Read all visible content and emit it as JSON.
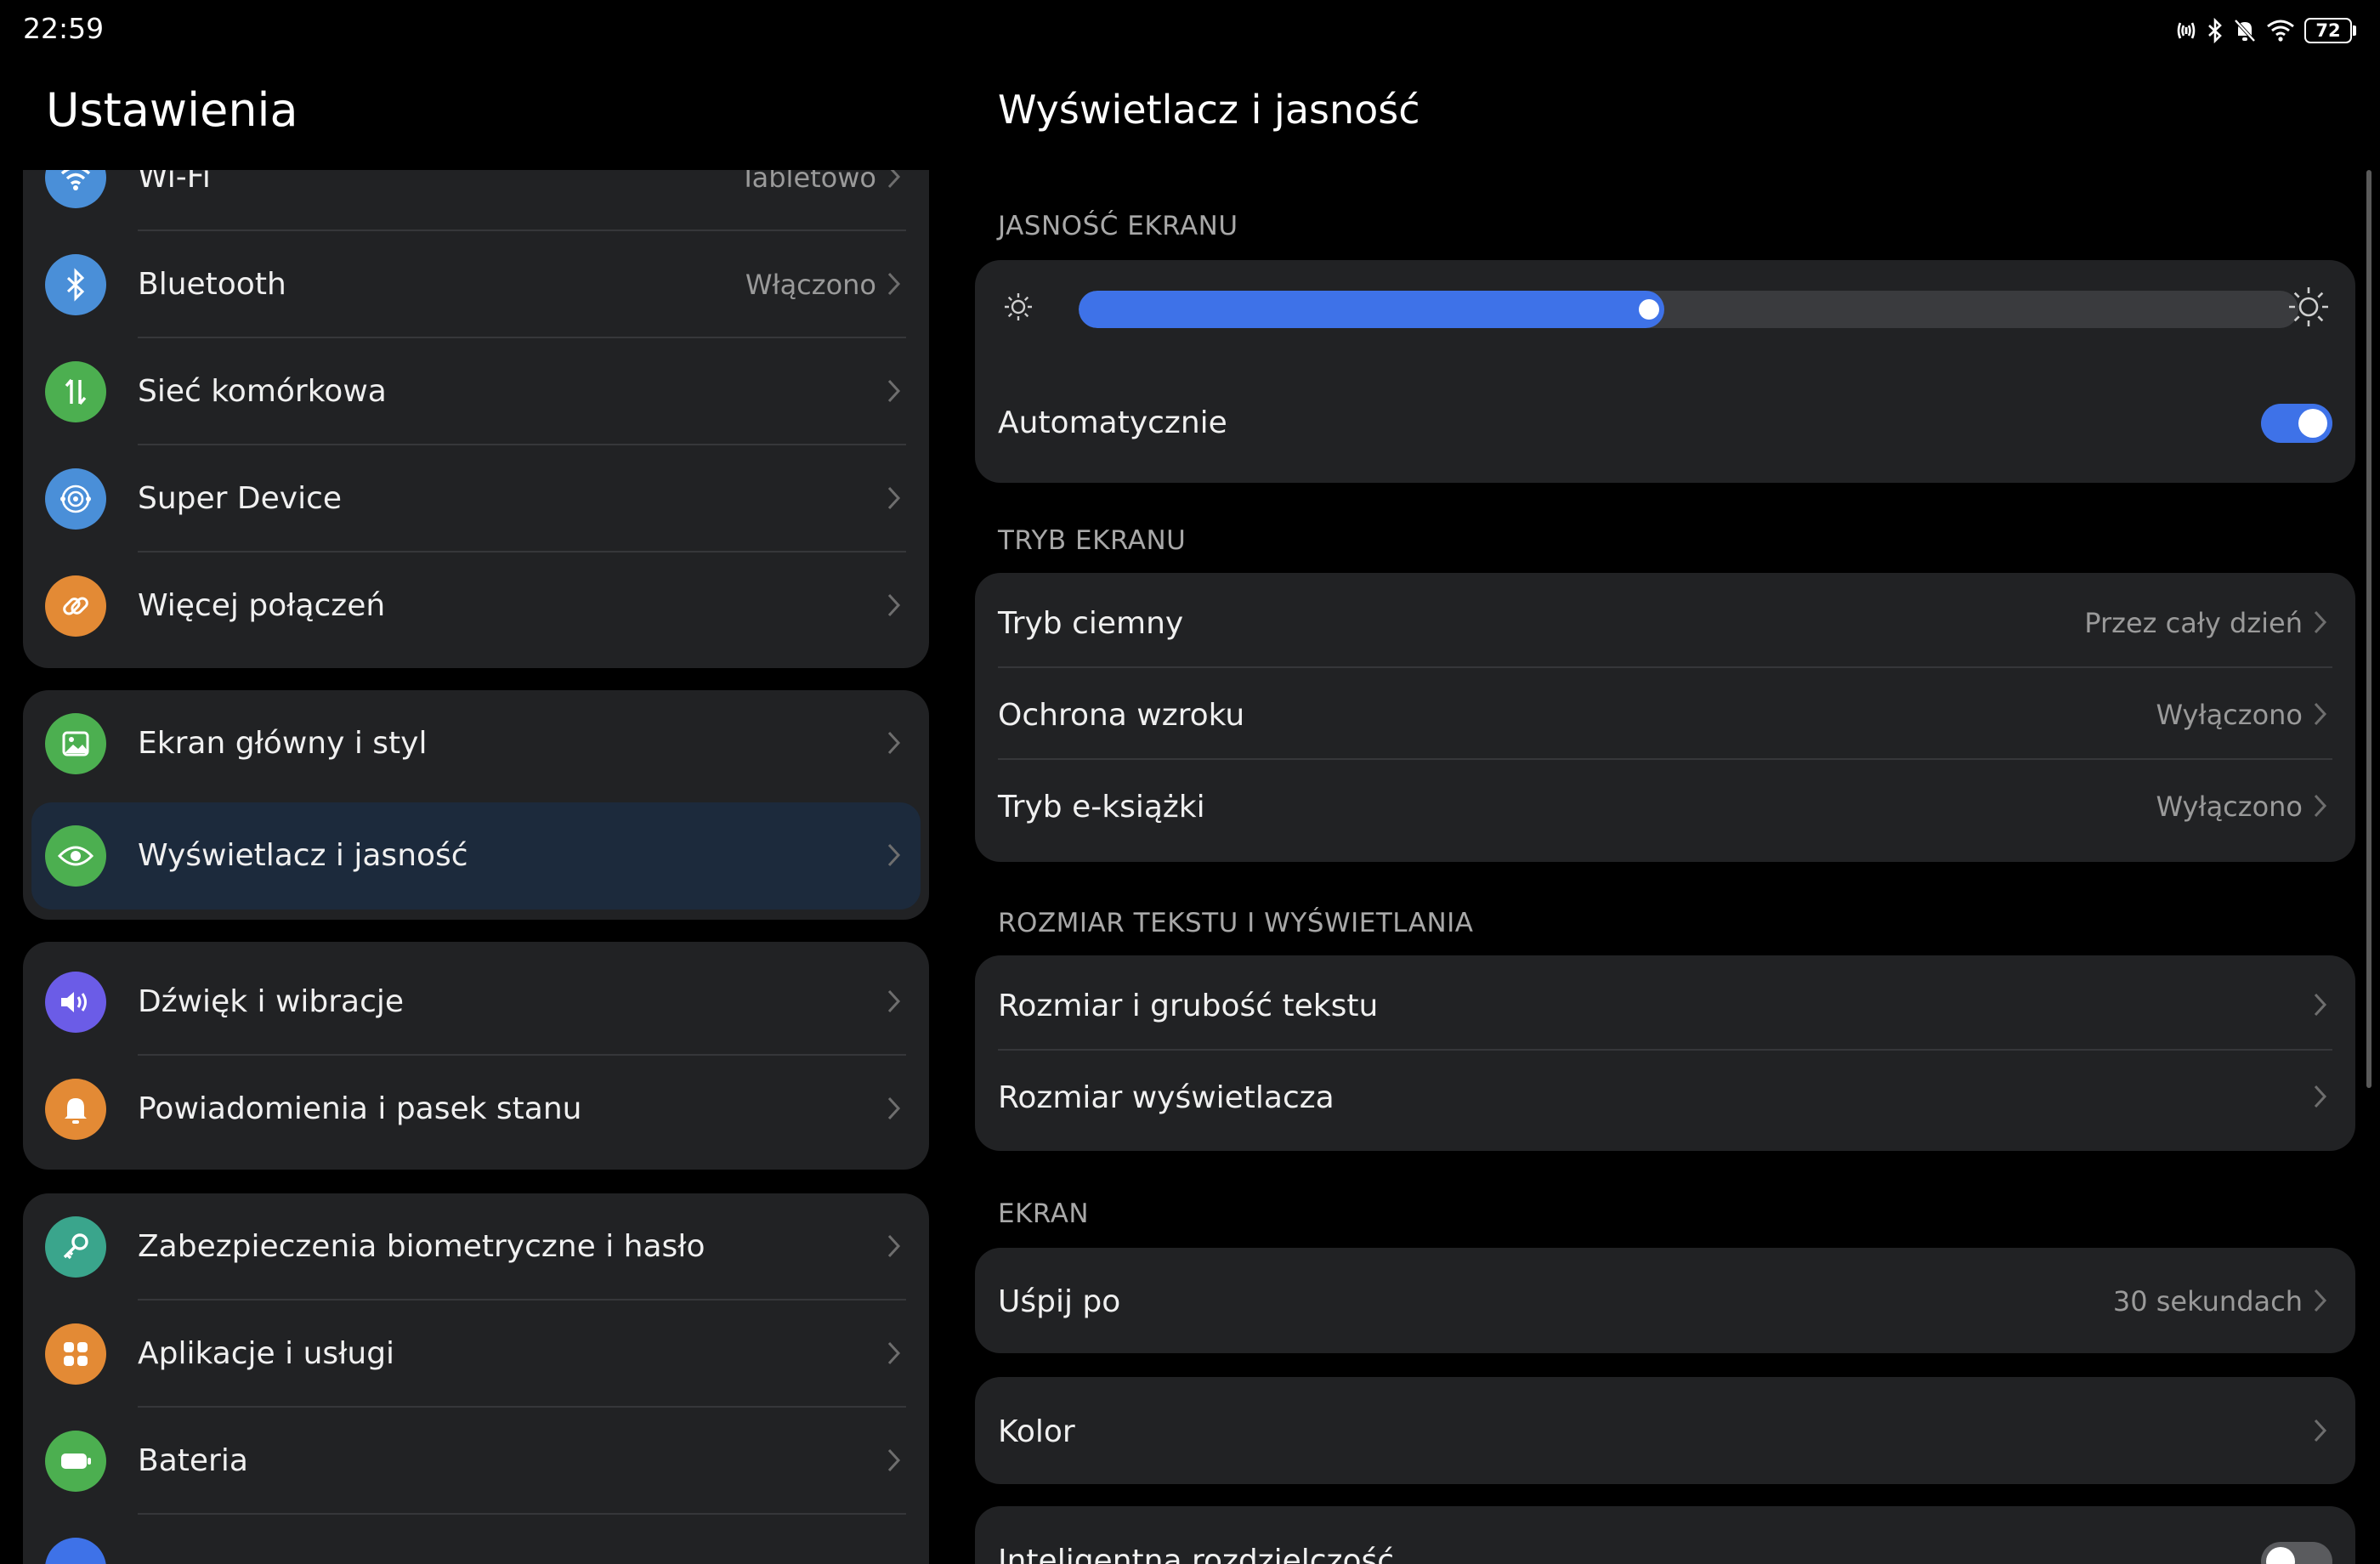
{
  "status_bar": {
    "time": "22:59",
    "icons": [
      "nfc-icon",
      "bluetooth-icon",
      "bell-muted-icon",
      "wifi-icon"
    ],
    "battery": "72"
  },
  "left": {
    "title": "Ustawienia",
    "groups": [
      {
        "items": [
          {
            "label": "Wi-Fi",
            "value": "Tabletowo",
            "icon": "wifi-icon",
            "color": "#4a8fd8"
          },
          {
            "label": "Bluetooth",
            "value": "Włączono",
            "icon": "bluetooth-icon",
            "color": "#4a8fd8"
          },
          {
            "label": "Sieć komórkowa",
            "value": "",
            "icon": "cellular-icon",
            "color": "#4caf50"
          },
          {
            "label": "Super Device",
            "value": "",
            "icon": "super-device-icon",
            "color": "#4a8fd8"
          },
          {
            "label": "Więcej połączeń",
            "value": "",
            "icon": "link-icon",
            "color": "#e38a35"
          }
        ]
      },
      {
        "items": [
          {
            "label": "Ekran główny i styl",
            "value": "",
            "icon": "image-icon",
            "color": "#4caf50"
          },
          {
            "label": "Wyświetlacz i jasność",
            "value": "",
            "icon": "eye-icon",
            "color": "#4caf50",
            "selected": true
          }
        ]
      },
      {
        "items": [
          {
            "label": "Dźwięk i wibracje",
            "value": "",
            "icon": "speaker-icon",
            "color": "#6b5ce7"
          },
          {
            "label": "Powiadomienia i pasek stanu",
            "value": "",
            "icon": "bell-icon",
            "color": "#e38a35"
          }
        ]
      },
      {
        "items": [
          {
            "label": "Zabezpieczenia biometryczne i hasło",
            "value": "",
            "icon": "key-icon",
            "color": "#3aa58c"
          },
          {
            "label": "Aplikacje i usługi",
            "value": "",
            "icon": "apps-icon",
            "color": "#e38a35"
          },
          {
            "label": "Bateria",
            "value": "",
            "icon": "battery-icon",
            "color": "#4caf50"
          }
        ]
      }
    ]
  },
  "right": {
    "title": "Wyświetlacz i jasność",
    "brightness": {
      "section": "JASNOŚĆ EKRANU",
      "level": 0.48,
      "auto_label": "Automatycznie",
      "auto_on": true
    },
    "mode": {
      "section": "TRYB EKRANU",
      "items": [
        {
          "label": "Tryb ciemny",
          "value": "Przez cały dzień"
        },
        {
          "label": "Ochrona wzroku",
          "value": "Wyłączono"
        },
        {
          "label": "Tryb e-książki",
          "value": "Wyłączono"
        }
      ]
    },
    "text_size": {
      "section": "ROZMIAR TEKSTU I WYŚWIETLANIA",
      "items": [
        {
          "label": "Rozmiar i grubość tekstu",
          "value": ""
        },
        {
          "label": "Rozmiar wyświetlacza",
          "value": ""
        }
      ]
    },
    "screen": {
      "section": "EKRAN",
      "sleep": {
        "label": "Uśpij po",
        "value": "30 sekundach"
      },
      "color": {
        "label": "Kolor",
        "value": ""
      },
      "smart_res": {
        "label": "Inteligentna rozdzielczość",
        "on": false
      }
    }
  },
  "colors": {
    "accent": "#3e72e8",
    "card": "#212224",
    "background": "#000000"
  }
}
